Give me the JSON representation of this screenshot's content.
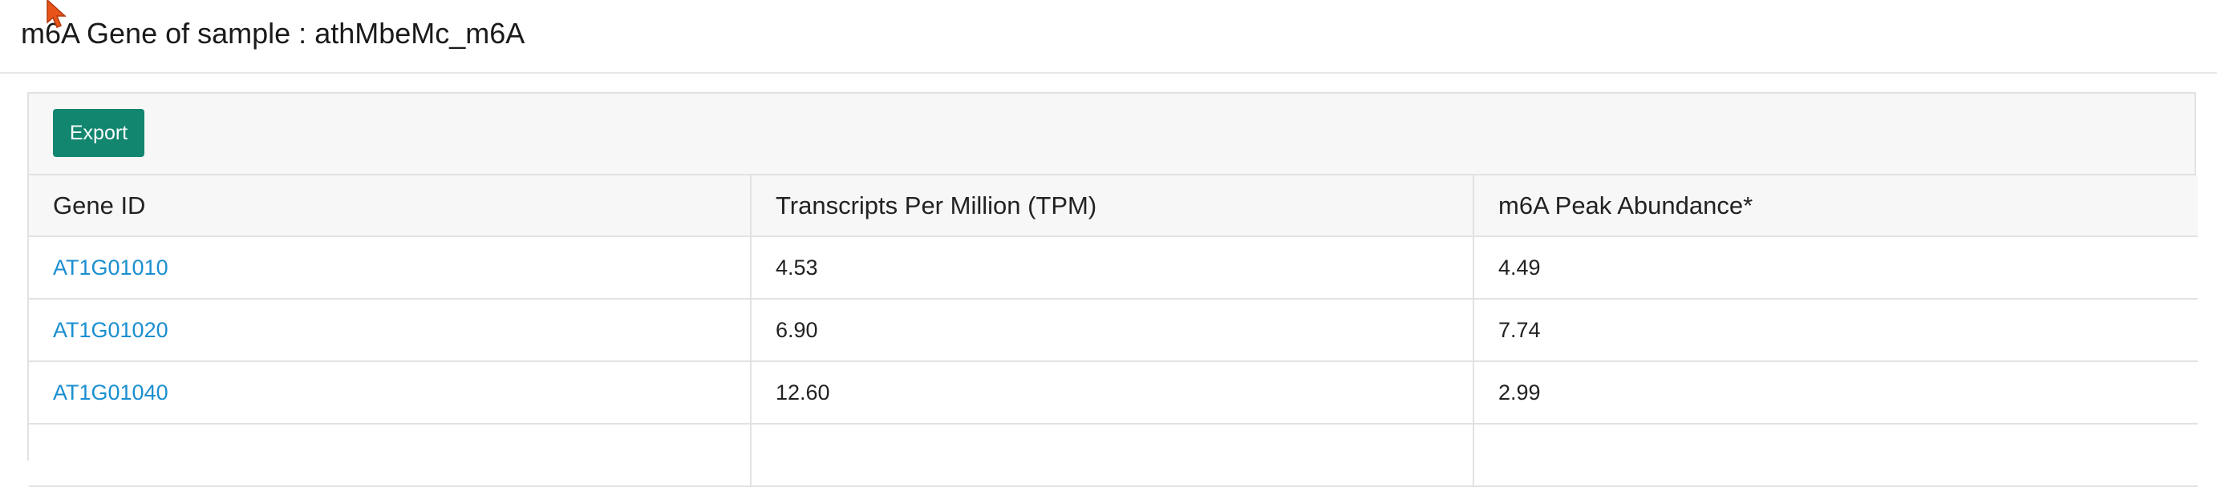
{
  "page": {
    "title": "m6A Gene of sample : athMbeMc_m6A"
  },
  "toolbar": {
    "export_label": "Export"
  },
  "table": {
    "columns": [
      "Gene ID",
      "Transcripts Per Million (TPM)",
      "m6A Peak Abundance*"
    ],
    "rows": [
      {
        "gene_id": "AT1G01010",
        "tpm": "4.53",
        "abundance": "4.49"
      },
      {
        "gene_id": "AT1G01020",
        "tpm": "6.90",
        "abundance": "7.74"
      },
      {
        "gene_id": "AT1G01040",
        "tpm": "12.60",
        "abundance": "2.99"
      },
      {
        "gene_id": "",
        "tpm": "",
        "abundance": ""
      }
    ]
  },
  "colors": {
    "accent": "#12866f",
    "link": "#1a8fd0",
    "cursor": "#e8541a"
  },
  "icons": {
    "cursor": "mouse-pointer-icon"
  }
}
